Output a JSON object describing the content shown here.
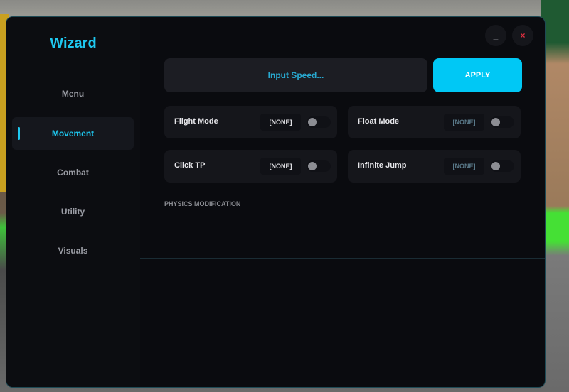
{
  "app": {
    "title": "Wizard"
  },
  "window_controls": {
    "minimize": "_",
    "close": "×"
  },
  "sidebar": {
    "items": [
      {
        "label": "Menu"
      },
      {
        "label": "Movement",
        "active": true
      },
      {
        "label": "Combat"
      },
      {
        "label": "Utility"
      },
      {
        "label": "Visuals"
      }
    ]
  },
  "speed": {
    "placeholder": "Input Speed...",
    "apply_label": "APPLY"
  },
  "toggles": [
    {
      "label": "Flight Mode",
      "key": "[NONE]",
      "on": false
    },
    {
      "label": "Float Mode",
      "key": "[NONE]",
      "on": false
    },
    {
      "label": "Click TP",
      "key": "[NONE]",
      "on": false
    },
    {
      "label": "Infinite Jump",
      "key": "[NONE]",
      "on": false
    }
  ],
  "sections": {
    "physics": "PHYSICS MODIFICATION"
  },
  "colors": {
    "accent": "#00c8f5",
    "background": "#0a0b0f",
    "card": "#15161b"
  }
}
